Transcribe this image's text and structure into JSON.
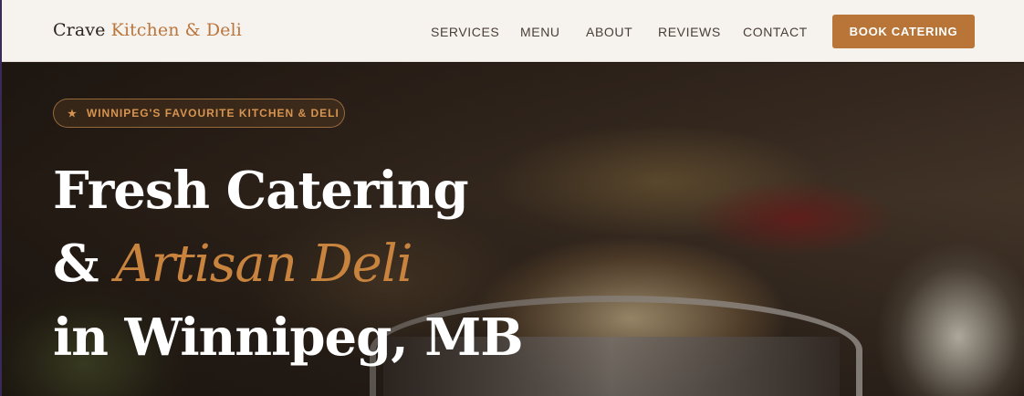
{
  "header": {
    "brand_primary": "Crave",
    "brand_secondary": "Kitchen & Deli",
    "nav": [
      {
        "label": "SERVICES"
      },
      {
        "label": "MENU"
      },
      {
        "label": "ABOUT"
      },
      {
        "label": "REVIEWS"
      },
      {
        "label": "CONTACT"
      }
    ],
    "cta_label": "BOOK CATERING"
  },
  "hero": {
    "badge_icon": "star-icon",
    "badge_text": "WINNIPEG'S FAVOURITE KITCHEN & DELI",
    "headline_line1": "Fresh Catering",
    "headline_amp": "&",
    "headline_accent": "Artisan Deli",
    "headline_line3": "in Winnipeg, MB"
  },
  "colors": {
    "accent": "#b87537",
    "header_bg": "#f6f2ee",
    "text_dark": "#2c2420"
  }
}
